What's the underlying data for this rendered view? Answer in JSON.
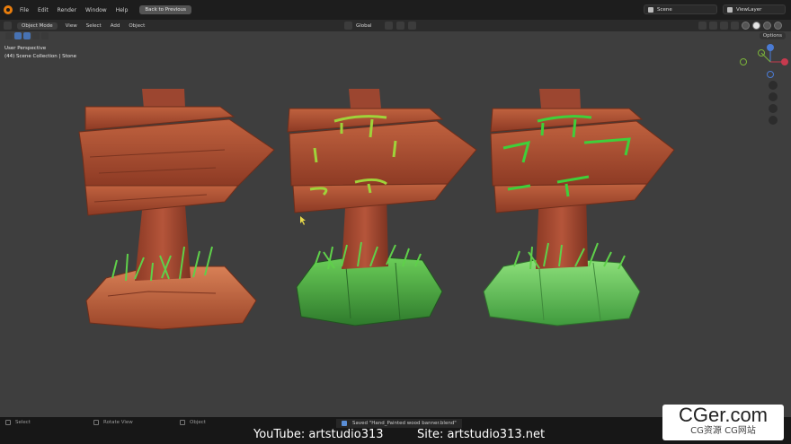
{
  "menu": {
    "file": "File",
    "edit": "Edit",
    "render": "Render",
    "window": "Window",
    "help": "Help",
    "back": "Back to Previous"
  },
  "scene": {
    "name": "Scene",
    "view_layer": "ViewLayer"
  },
  "viewport_header": {
    "mode": "Object Mode",
    "view": "View",
    "select": "Select",
    "add": "Add",
    "object": "Object",
    "orientation": "Global",
    "options": "Options"
  },
  "overlay": {
    "perspective": "User Perspective",
    "collection": "(44) Scene Collection | Stone"
  },
  "gizmo": {
    "x": "X",
    "y": "Y",
    "z": "Z"
  },
  "status": {
    "select": "Select",
    "rotate": "Rotate View",
    "object": "Object",
    "saved": "Saved \"Hand_Painted wood banner.blend\""
  },
  "captions": {
    "youtube": "YouTube: artstudio313",
    "site": "Site: artstudio313.net"
  },
  "watermark": {
    "main": "CGer.com",
    "sub": "CG资源  CG网站"
  },
  "colors": {
    "viewport": "#3e3e3e",
    "wood": "#a6492e",
    "grass": "#4fc24a",
    "rock_orange": "#c0653f",
    "rock_green": "#59b04e",
    "accent": "#4772b3"
  }
}
